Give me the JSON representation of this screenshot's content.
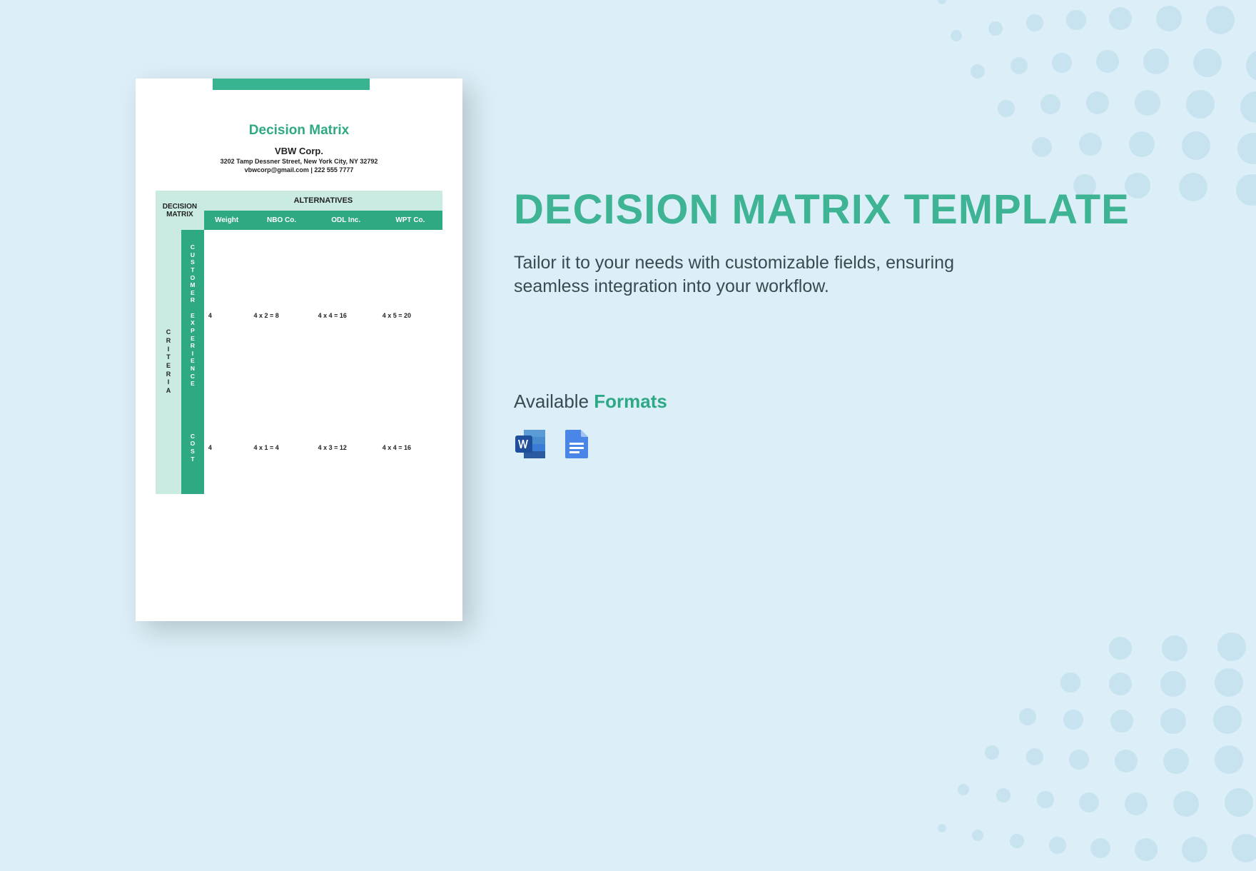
{
  "document": {
    "title": "Decision Matrix",
    "company": "VBW Corp.",
    "address": "3202 Tamp Dessner Street, New York City, NY 32792",
    "contact": "vbwcorp@gmail.com | 222 555 7777",
    "headers": {
      "decision_matrix": "DECISION\nMATRIX",
      "alternatives": "ALTERNATIVES",
      "weight": "Weight",
      "alt1": "NBO Co.",
      "alt2": "ODL Inc.",
      "alt3": "WPT Co.",
      "criteria_label": "CRITERIA"
    },
    "rows": [
      {
        "criteria": "CUSTOMER EXPERIENCE",
        "weight": "4",
        "alt1": "4 x 2 = 8",
        "alt2": "4 x 4 = 16",
        "alt3": "4 x 5 = 20"
      },
      {
        "criteria": "COST",
        "weight": "4",
        "alt1": "4 x 1 = 4",
        "alt2": "4 x 3 = 12",
        "alt3": "4 x 4 = 16"
      }
    ]
  },
  "panel": {
    "title": "DECISION MATRIX TEMPLATE",
    "description": "Tailor it to your needs with customizable fields, ensuring seamless integration into your workflow.",
    "formats_label_plain": "Available ",
    "formats_label_accent": "Formats",
    "icons": {
      "word": "ms-word-icon",
      "gdocs": "google-docs-icon"
    }
  }
}
